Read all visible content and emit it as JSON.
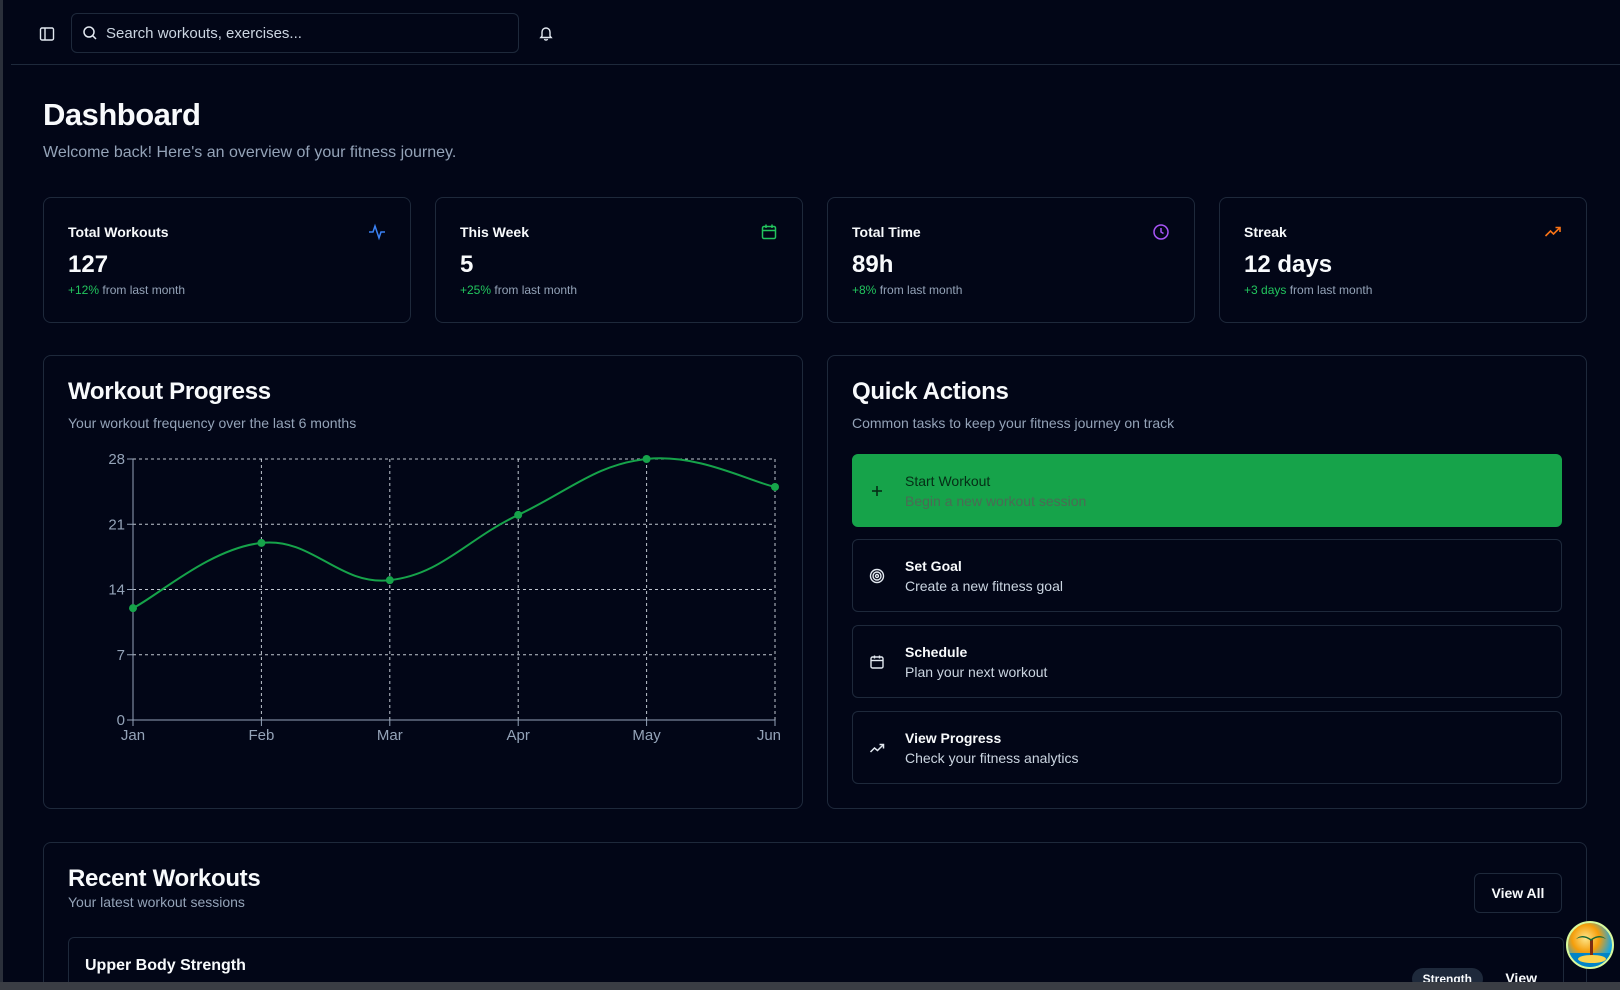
{
  "header": {
    "search_placeholder": "Search workouts, exercises...",
    "sidebar_toggle_icon": "sidebar-icon",
    "notification_icon": "bell-icon"
  },
  "page": {
    "title": "Dashboard",
    "subtitle": "Welcome back! Here's an overview of your fitness journey."
  },
  "stats": [
    {
      "label": "Total Workouts",
      "value": "127",
      "change": "+12%",
      "change_text": " from last month",
      "icon": "activity-icon",
      "icon_color": "#3b82f6"
    },
    {
      "label": "This Week",
      "value": "5",
      "change": "+25%",
      "change_text": " from last month",
      "icon": "calendar-icon",
      "icon_color": "#22c55e"
    },
    {
      "label": "Total Time",
      "value": "89h",
      "change": "+8%",
      "change_text": " from last month",
      "icon": "clock-icon",
      "icon_color": "#a855f7"
    },
    {
      "label": "Streak",
      "value": "12 days",
      "change": "+3 days",
      "change_text": " from last month",
      "icon": "trending-up-icon",
      "icon_color": "#f97316"
    }
  ],
  "progress": {
    "title": "Workout Progress",
    "subtitle": "Your workout frequency over the last 6 months"
  },
  "chart_data": {
    "type": "line",
    "categories": [
      "Jan",
      "Feb",
      "Mar",
      "Apr",
      "May",
      "Jun"
    ],
    "series": [
      {
        "values": [
          12,
          19,
          15,
          22,
          28,
          25
        ]
      }
    ],
    "yticks": [
      "0",
      "7",
      "14",
      "21",
      "28"
    ],
    "ylim": [
      0,
      28
    ],
    "grid": true,
    "line_color": "#16a34a"
  },
  "quick_actions": {
    "title": "Quick Actions",
    "subtitle": "Common tasks to keep your fitness journey on track",
    "items": [
      {
        "title": "Start Workout",
        "desc": "Begin a new workout session",
        "icon": "plus-icon"
      },
      {
        "title": "Set Goal",
        "desc": "Create a new fitness goal",
        "icon": "target-icon"
      },
      {
        "title": "Schedule",
        "desc": "Plan your next workout",
        "icon": "calendar-icon"
      },
      {
        "title": "View Progress",
        "desc": "Check your fitness analytics",
        "icon": "trending-up-icon"
      }
    ]
  },
  "recent": {
    "title": "Recent Workouts",
    "subtitle": "Your latest workout sessions",
    "view_all": "View All",
    "items": [
      {
        "name": "Upper Body Strength",
        "tag": "Strength",
        "action": "View"
      }
    ]
  },
  "colors": {
    "background": "#020617",
    "border": "#1e293b",
    "accent": "#16a34a"
  }
}
